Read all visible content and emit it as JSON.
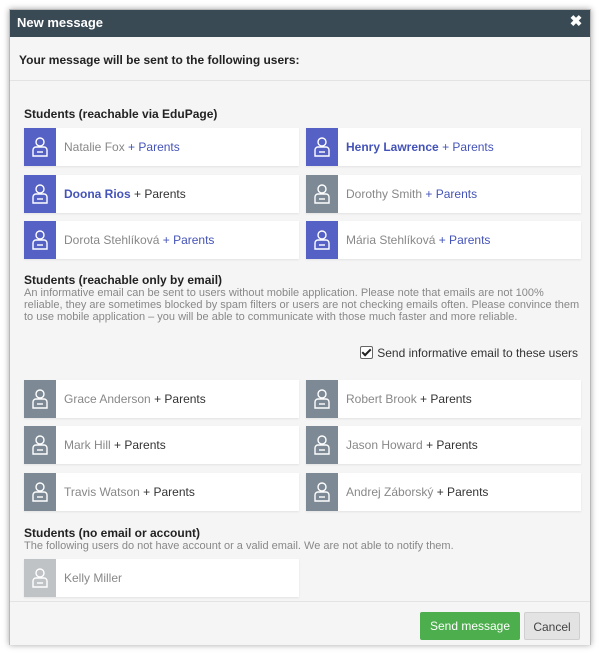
{
  "dialog": {
    "title": "New message",
    "close_glyph": "✖",
    "subheader": "Your message will be sent to the following users:"
  },
  "sections": {
    "edupage": {
      "title": "Students (reachable via EduPage)",
      "users": [
        {
          "name": "Natalie Fox",
          "suffix": "+ Parents",
          "name_style": "normal",
          "suffix_style": "link"
        },
        {
          "name": "Henry Lawrence",
          "suffix": "+ Parents",
          "name_style": "bold",
          "suffix_style": "link"
        },
        {
          "name": "Doona Rios",
          "suffix": "+ Parents",
          "name_style": "bold",
          "suffix_style": "plain"
        },
        {
          "name": "Dorothy Smith",
          "suffix": "+ Parents",
          "name_style": "normal",
          "suffix_style": "link"
        },
        {
          "name": "Dorota Stehlíková",
          "suffix": "+ Parents",
          "name_style": "normal",
          "suffix_style": "link"
        },
        {
          "name": "Mária Stehlíková",
          "suffix": "+ Parents",
          "name_style": "normal",
          "suffix_style": "link"
        }
      ]
    },
    "email": {
      "title": "Students (reachable only by email)",
      "description": "An informative email can be sent to users without mobile application. Please note that emails are not 100% reliable, they are sometimes blocked by spam filters or users are not checking emails often. Please convince them to use mobile application – you will be able to communicate with those much faster and more reliable.",
      "checkbox_label": "Send informative email to these users",
      "checkbox_checked": true,
      "users": [
        {
          "name": "Grace Anderson",
          "suffix": "+ Parents"
        },
        {
          "name": "Robert Brook",
          "suffix": "+ Parents"
        },
        {
          "name": "Mark Hill",
          "suffix": "+ Parents"
        },
        {
          "name": "Jason Howard",
          "suffix": "+ Parents"
        },
        {
          "name": "Travis Watson",
          "suffix": "+ Parents"
        },
        {
          "name": "Andrej Záborský",
          "suffix": "+ Parents"
        }
      ]
    },
    "none": {
      "title": "Students (no email or account)",
      "description": "The following users do not have account or a valid email. We are not able to notify them.",
      "users": [
        {
          "name": "Kelly Miller",
          "suffix": ""
        }
      ]
    }
  },
  "footer": {
    "send_label": "Send message",
    "cancel_label": "Cancel"
  },
  "colors": {
    "titlebar": "#3a4a55",
    "edupage_icon": "#5561c4",
    "email_icon": "#7d8a96",
    "none_icon": "#bfc3c6",
    "link": "#4453b8",
    "send_button": "#4cae4c"
  },
  "icons": {
    "user": "user-icon",
    "close": "close-icon",
    "checkbox": "checkbox-icon"
  }
}
